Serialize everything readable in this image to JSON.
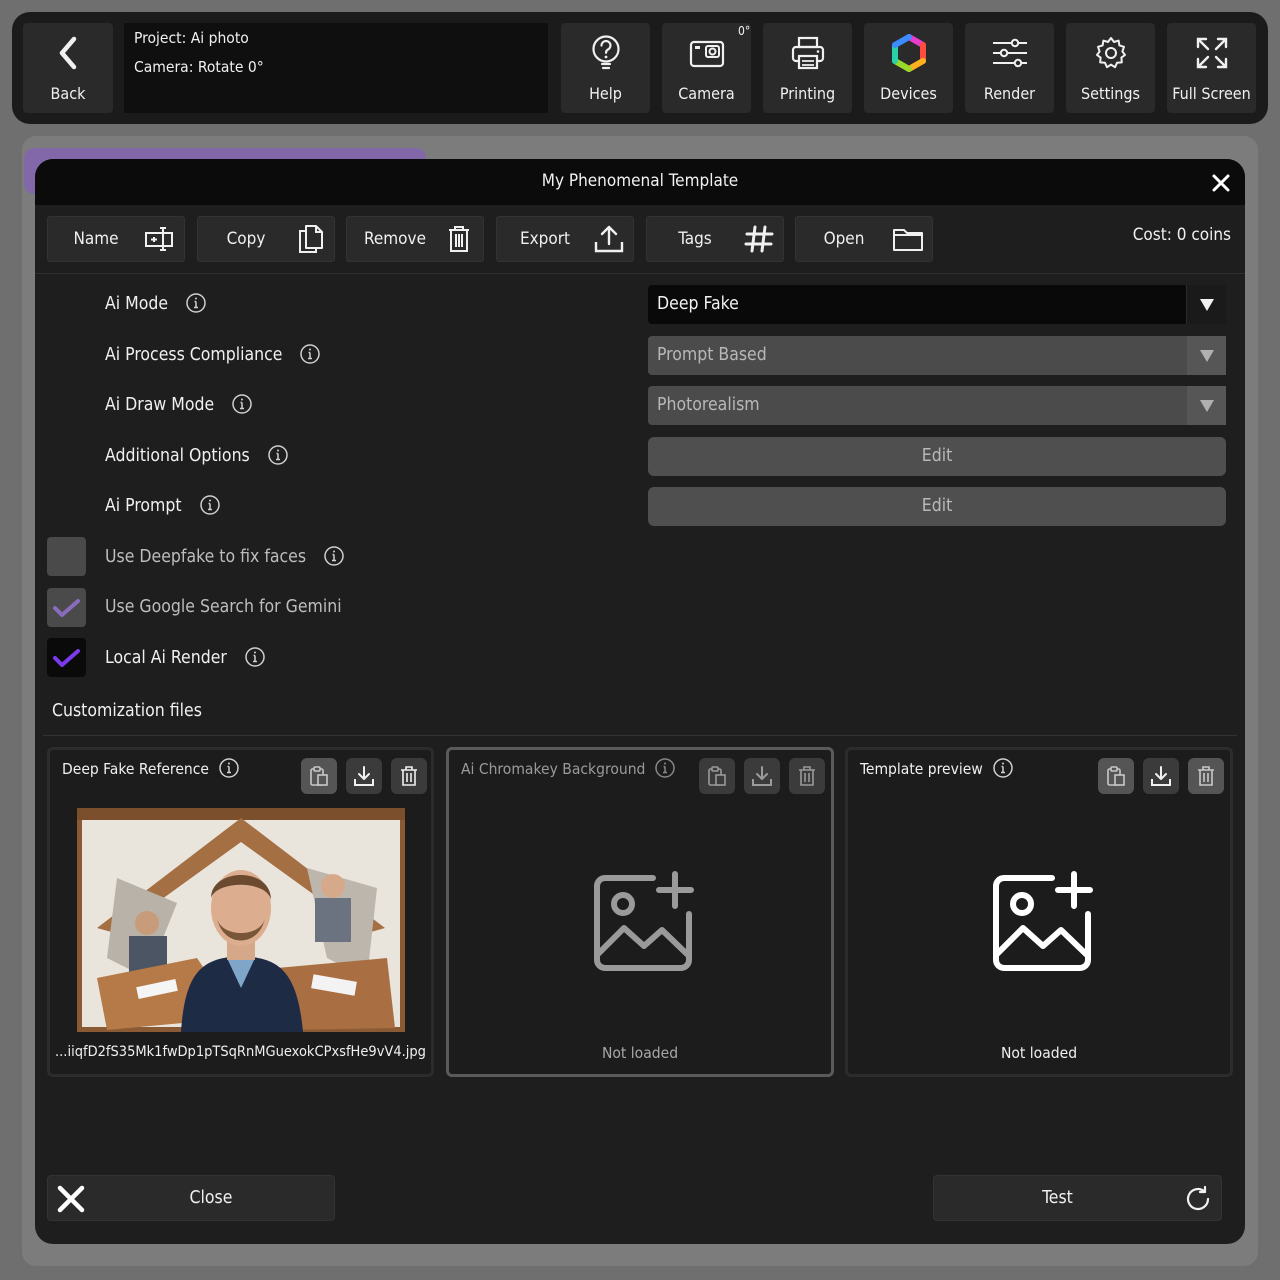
{
  "topbar": {
    "back_label": "Back",
    "project_line": "Project: Ai photo",
    "camera_line": "Camera: Rotate 0°",
    "camera_rotation_badge": "0°",
    "buttons": [
      {
        "label": "Help",
        "icon": "help-icon"
      },
      {
        "label": "Camera",
        "icon": "camera-icon"
      },
      {
        "label": "Printing",
        "icon": "printer-icon"
      },
      {
        "label": "Devices",
        "icon": "devices-icon"
      },
      {
        "label": "Render",
        "icon": "sliders-icon"
      },
      {
        "label": "Settings",
        "icon": "gear-icon"
      },
      {
        "label": "Full Screen",
        "icon": "fullscreen-icon"
      }
    ]
  },
  "modal": {
    "title": "My Phenomenal Template",
    "cost": "Cost: 0 coins",
    "actions": [
      {
        "label": "Name",
        "icon": "rename-icon"
      },
      {
        "label": "Copy",
        "icon": "copy-icon"
      },
      {
        "label": "Remove",
        "icon": "trash-icon"
      },
      {
        "label": "Export",
        "icon": "upload-icon"
      },
      {
        "label": "Tags",
        "icon": "hashtag-icon"
      },
      {
        "label": "Open",
        "icon": "folder-icon"
      }
    ],
    "settings": {
      "ai_mode_label": "Ai Mode",
      "ai_mode_value": "Deep Fake",
      "ai_process_label": "Ai Process Compliance",
      "ai_process_value": "Prompt Based",
      "ai_draw_label": "Ai Draw Mode",
      "ai_draw_value": "Photorealism",
      "additional_label": "Additional Options",
      "additional_button": "Edit",
      "ai_prompt_label": "Ai Prompt",
      "ai_prompt_button": "Edit",
      "deepfake_faces_label": "Use Deepfake to fix faces",
      "deepfake_faces_checked": false,
      "google_search_label": "Use Google Search for Gemini",
      "google_search_checked": true,
      "local_render_label": "Local Ai Render",
      "local_render_checked": true
    },
    "files": {
      "section_title": "Customization files",
      "cards": [
        {
          "title": "Deep Fake Reference",
          "footer": "...iiqfD2fS35Mk1fwDp1pTSqRnMGuexokCPxsfHe9vV4.jpg"
        },
        {
          "title": "Ai Chromakey Background",
          "footer": "Not loaded"
        },
        {
          "title": "Template preview",
          "footer": "Not loaded"
        }
      ]
    },
    "close_label": "Close",
    "test_label": "Test"
  },
  "colors": {
    "accent_purple": "#7c3aed",
    "accent_purple_dim": "#8a6bc0",
    "modal_bg": "#1e1e1e",
    "title_bg": "#0b0b0b"
  }
}
